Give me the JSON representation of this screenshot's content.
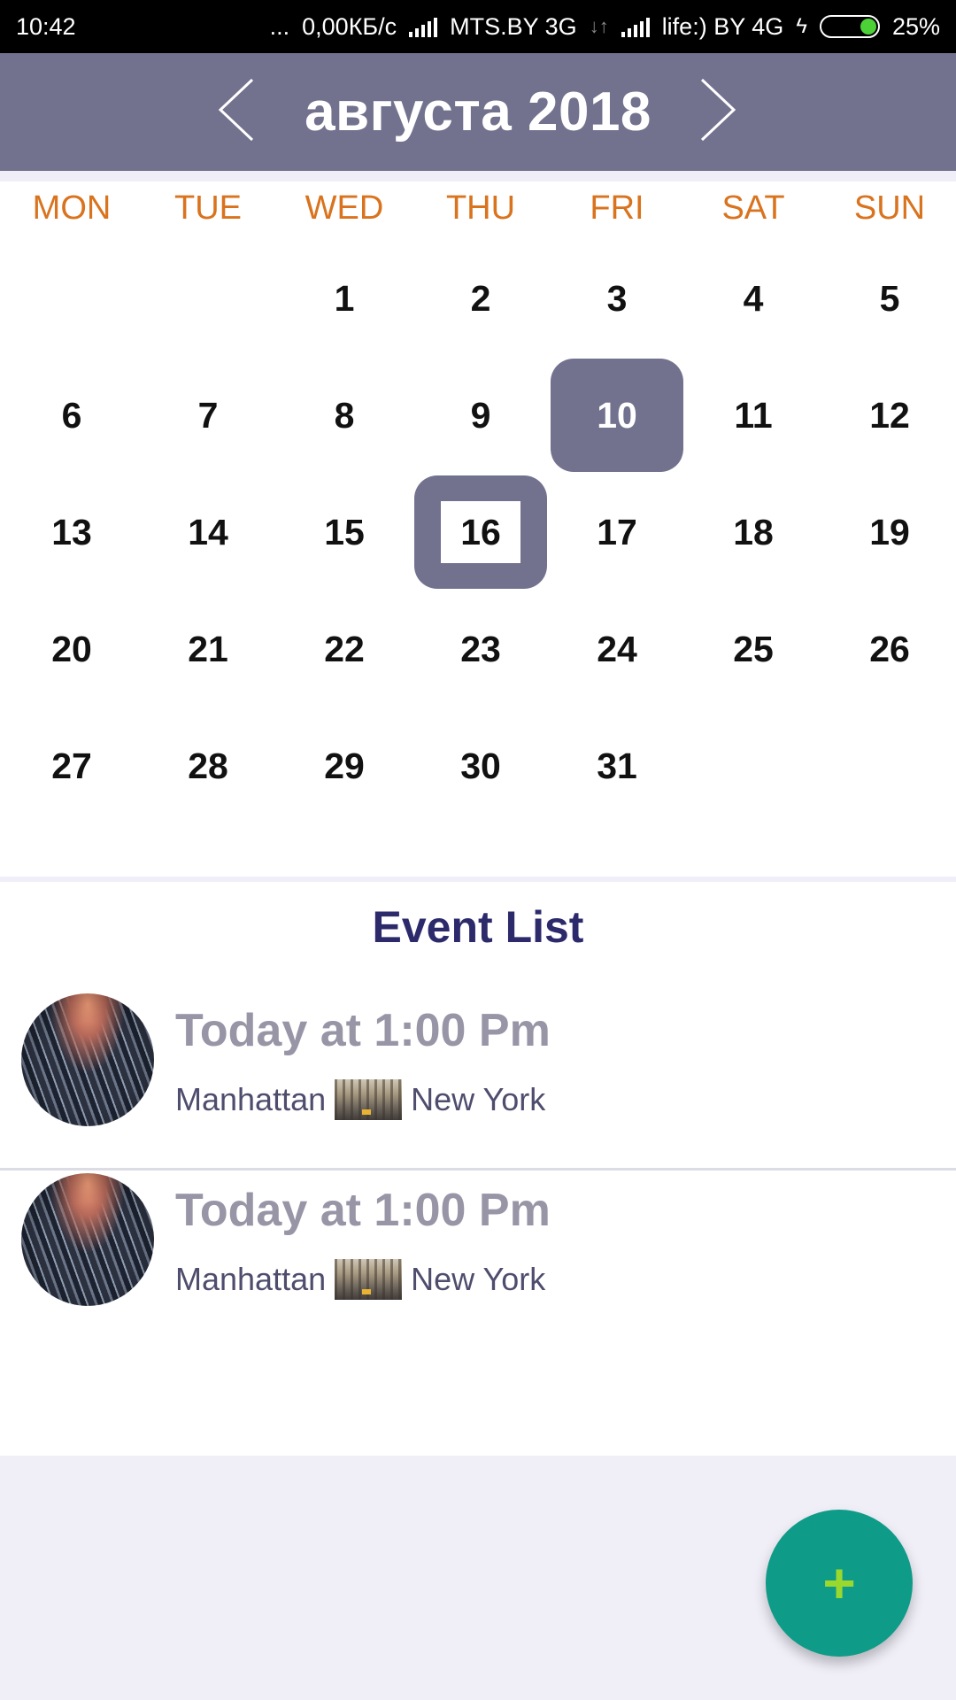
{
  "status_bar": {
    "time": "10:42",
    "dots": "...",
    "speed": "0,00КБ/с",
    "carrier1": "MTS.BY 3G",
    "carrier2": "life:) BY 4G",
    "battery": "25%"
  },
  "header": {
    "month_title": "августа 2018",
    "prev_icon": "chevron-left-icon",
    "next_icon": "chevron-right-icon"
  },
  "calendar": {
    "weekdays": [
      "MON",
      "TUE",
      "WED",
      "THU",
      "FRI",
      "SAT",
      "SUN"
    ],
    "weeks": [
      [
        "",
        "",
        "1",
        "2",
        "3",
        "4",
        "5"
      ],
      [
        "6",
        "7",
        "8",
        "9",
        "10",
        "11",
        "12"
      ],
      [
        "13",
        "14",
        "15",
        "16",
        "17",
        "18",
        "19"
      ],
      [
        "20",
        "21",
        "22",
        "23",
        "24",
        "25",
        "26"
      ],
      [
        "27",
        "28",
        "29",
        "30",
        "31",
        "",
        ""
      ]
    ],
    "selected_day": "10",
    "today_day": "16"
  },
  "events": {
    "title": "Event List",
    "items": [
      {
        "time": "Today at 1:00 Pm",
        "place": "Manhattan",
        "city": "New York"
      },
      {
        "time": "Today at 1:00 Pm",
        "place": "Manhattan",
        "city": "New York"
      }
    ]
  },
  "fab": {
    "label": "+"
  },
  "colors": {
    "header": "#72728f",
    "weekday": "#d9731e",
    "event_title": "#2c2a6b",
    "fab": "#0e9b88",
    "fab_plus": "#9ad82e"
  }
}
